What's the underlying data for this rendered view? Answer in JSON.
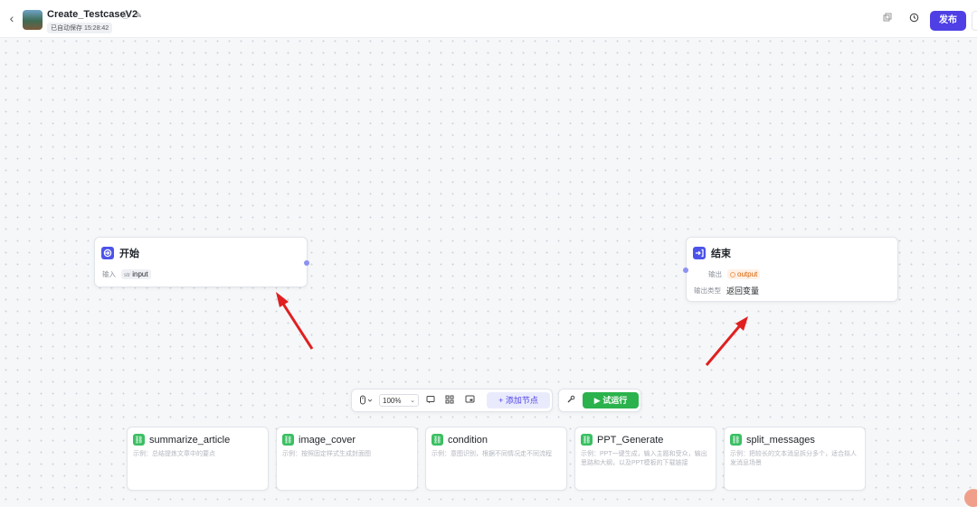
{
  "header": {
    "title": "Create_TestcaseV2",
    "info_glyph": "ⓘ",
    "edit_glyph": "✎",
    "autosave": "已自动保存 15:28:42",
    "publish_label": "发布",
    "icons": [
      "back-icon",
      "info-icon",
      "edit-icon",
      "copy-icon",
      "history-icon"
    ]
  },
  "nodes": {
    "start": {
      "title": "开始",
      "input_label": "输入",
      "input_type": "str",
      "input_name": "input"
    },
    "end": {
      "title": "结束",
      "output_label": "输出",
      "output_name": "output",
      "output_type_label": "输出类型",
      "output_type_value": "返回变量"
    }
  },
  "toolbar": {
    "zoom": "100%",
    "add_node_label": "+ 添加节点",
    "run_label": "▶ 试运行"
  },
  "templates": [
    {
      "title": "summarize_article",
      "desc": "示例：总结提炼文章中的要点"
    },
    {
      "title": "image_cover",
      "desc": "示例：按照固定样式生成封面图"
    },
    {
      "title": "condition",
      "desc": "示例：意图识别，根据不同情况走不同流程"
    },
    {
      "title": "PPT_Generate",
      "desc": "示例：PPT一键生成，输入主题和受众，输出思路和大纲，以及PPT模板的下载链接"
    },
    {
      "title": "split_messages",
      "desc": "示例：把较长的文本消息拆分多个，适合拟人发消息场景"
    }
  ],
  "colors": {
    "accent": "#4e40e5",
    "run_green": "#2bb24c",
    "arrow_red": "#e02020",
    "template_green": "#3bbf63"
  }
}
